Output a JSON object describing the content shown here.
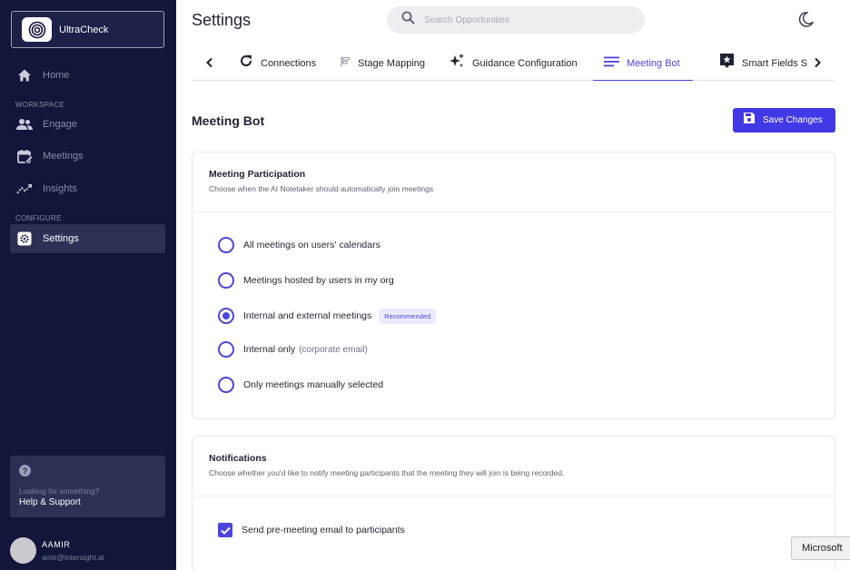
{
  "org": {
    "name": "UltraCheck"
  },
  "sidebar": {
    "home_label": "Home",
    "workspace_label": "WORKSPACE",
    "configure_label": "CONFIGURE",
    "items": [
      {
        "label": "Engage",
        "icon": "people-icon"
      },
      {
        "label": "Meetings",
        "icon": "calendar-edit-icon"
      },
      {
        "label": "Insights",
        "icon": "trending-icon"
      },
      {
        "label": "Settings",
        "icon": "gear-icon"
      }
    ],
    "help": {
      "subtitle": "Looking for something?",
      "title": "Help & Support"
    },
    "user": {
      "name": "AAMIR",
      "email": "amir@intersight.ai"
    }
  },
  "header": {
    "title": "Settings",
    "search_placeholder": "Search Opportunities"
  },
  "tabs": [
    {
      "label": "Connections",
      "icon": "refresh-icon"
    },
    {
      "label": "Stage Mapping",
      "icon": "stage-mapping-icon"
    },
    {
      "label": "Guidance Configuration",
      "icon": "sparkle-icon"
    },
    {
      "label": "Meeting Bot",
      "icon": "lines-icon",
      "active": true
    },
    {
      "label": "Smart Fields Su",
      "icon": "star-box-icon"
    }
  ],
  "section": {
    "title": "Meeting Bot",
    "save_label": "Save Changes"
  },
  "participation": {
    "title": "Meeting Participation",
    "description": "Choose when the AI Notetaker should automatically join meetings",
    "options": [
      {
        "label": "All meetings on users' calendars",
        "checked": false
      },
      {
        "label": "Meetings hosted by users in my org",
        "checked": false
      },
      {
        "label": "Internal and external meetings",
        "checked": true,
        "badge": "Recommended"
      },
      {
        "label": "Internal only",
        "note": "(corporate email)",
        "checked": false
      },
      {
        "label": "Only meetings manually selected",
        "checked": false
      }
    ]
  },
  "notifications": {
    "title": "Notifications",
    "description": "Choose whether you'd like to notify meeting participants that the meeting they will join is being recorded.",
    "option": {
      "label": "Send pre-meeting email to participants",
      "checked": true
    }
  },
  "tooltip": {
    "text": "Microsoft"
  },
  "colors": {
    "sidebar": "#13163a",
    "accent": "#4b45e0",
    "button": "#4338e6"
  }
}
